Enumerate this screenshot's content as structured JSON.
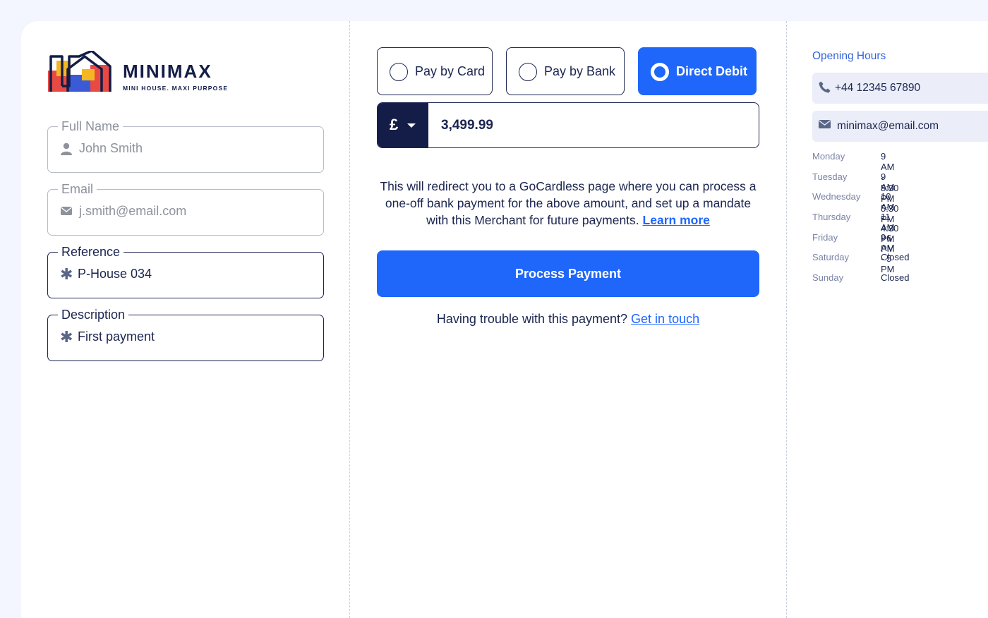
{
  "brand": {
    "name": "MINIMAX",
    "tagline": "MINI HOUSE. MAXI PURPOSE"
  },
  "form": {
    "full_name": {
      "label": "Full Name",
      "placeholder": "John Smith",
      "icon": "user-icon"
    },
    "email": {
      "label": "Email",
      "placeholder": "j.smith@email.com",
      "icon": "envelope-icon"
    },
    "reference": {
      "label": "Reference",
      "value": "P-House 034",
      "icon": "asterisk-icon"
    },
    "description": {
      "label": "Description",
      "value": "First payment",
      "icon": "asterisk-icon"
    }
  },
  "payment": {
    "options": [
      {
        "label": "Pay by Card",
        "selected": false
      },
      {
        "label": "Pay by Bank",
        "selected": false
      },
      {
        "label": "Direct Debit",
        "selected": true
      }
    ],
    "currency_symbol": "£",
    "amount": "3,499.99",
    "info_text": "This will redirect you to a GoCardless page where you can process a one-off bank payment for the above amount, and set up a mandate with this Merchant for future payments.",
    "learn_more": "Learn more",
    "process_button": "Process Payment",
    "trouble_text": "Having trouble with this payment?",
    "trouble_link": "Get in touch"
  },
  "contact": {
    "title": "Opening Hours",
    "phone": "+44 12345 67890",
    "email": "minimax@email.com",
    "hours": [
      {
        "day": "Monday",
        "time": "9 AM - 5:30 PM"
      },
      {
        "day": "Tuesday",
        "time": "9 AM - 5:30 PM"
      },
      {
        "day": "Wednesday",
        "time": "10 AM - 4:30 PM"
      },
      {
        "day": "Thursday",
        "time": "11 AM - 6 PM"
      },
      {
        "day": "Friday",
        "time": "9 AM  - 5 PM"
      },
      {
        "day": "Saturday",
        "time": "Closed"
      },
      {
        "day": "Sunday",
        "time": "Closed"
      }
    ]
  },
  "colors": {
    "accent": "#1f66fb",
    "navy": "#131d47",
    "background": "#f3f6fe"
  }
}
